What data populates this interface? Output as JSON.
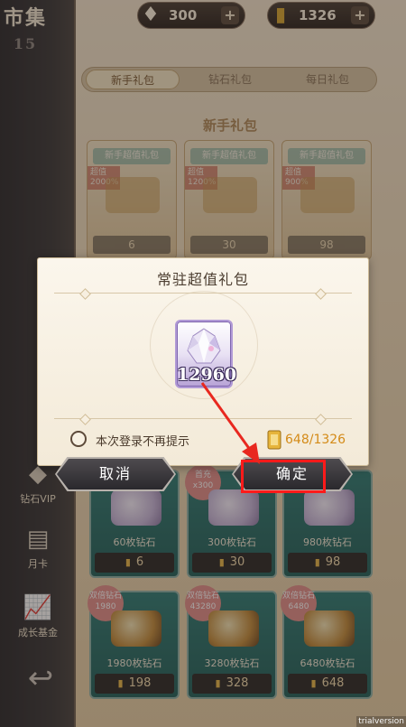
{
  "screen": {
    "title": "市集",
    "badge": "15"
  },
  "currencies": [
    {
      "icon": "diamond-icon",
      "value": "300",
      "plus": "+"
    },
    {
      "icon": "gold-ticket-icon",
      "value": "1326",
      "plus": "+"
    }
  ],
  "tabs": [
    {
      "label": "新手礼包",
      "active": true
    },
    {
      "label": "钻石礼包",
      "active": false
    },
    {
      "label": "每日礼包",
      "active": false
    }
  ],
  "section_title": "新手礼包",
  "packs": [
    {
      "title": "新手超值礼包",
      "badge": "超值 2000%",
      "price": "6"
    },
    {
      "title": "新手超值礼包",
      "badge": "超值 1200%",
      "price": "30"
    },
    {
      "title": "新手超值礼包",
      "badge": "超值 900%",
      "price": "98"
    }
  ],
  "left_rail": [
    {
      "label": "钻石VIP",
      "icon": "diamond-vip-icon"
    },
    {
      "label": "月卡",
      "icon": "month-card-icon"
    },
    {
      "label": "成长基金",
      "icon": "growth-fund-icon"
    }
  ],
  "shop_row1": [
    {
      "name": "60枚钻石",
      "price": "6",
      "tag": ""
    },
    {
      "name": "300枚钻石",
      "price": "30",
      "tag": "首充 x300"
    },
    {
      "name": "980枚钻石",
      "price": "98",
      "tag": ""
    }
  ],
  "shop_row2": [
    {
      "name": "1980枚钻石",
      "price": "198",
      "tag": "双倍钻石 1980"
    },
    {
      "name": "3280枚钻石",
      "price": "328",
      "tag": "双倍钻石 43280"
    },
    {
      "name": "6480枚钻石",
      "price": "648",
      "tag": "双倍钻石 6480"
    }
  ],
  "dialog": {
    "title": "常驻超值礼包",
    "item": {
      "icon": "diamond-crystal-icon",
      "count": "12960"
    },
    "no_remind_label": "本次登录不再提示",
    "cost": "648/1326",
    "cancel_label": "取消",
    "confirm_label": "确定"
  },
  "watermark": "trialversion",
  "colors": {
    "cost_text": "#d48b18",
    "highlight": "#ff1a1a",
    "button_bg": "#2a292d"
  }
}
